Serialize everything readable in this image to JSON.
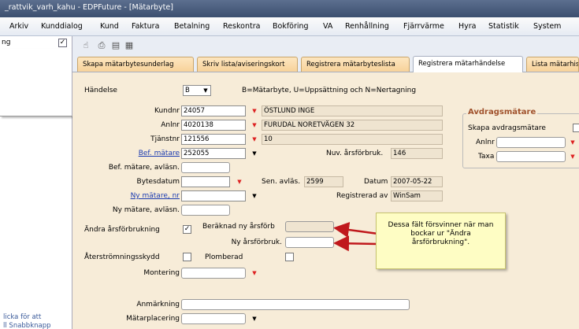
{
  "title": "_rattvik_varh_kahu - EDPFuture - [Mätarbyte]",
  "menu": [
    "Arkiv",
    "Kunddialog",
    "Kund",
    "Faktura",
    "Betalning",
    "Reskontra",
    "Bokföring",
    "VA",
    "Renhållning",
    "Fjärrvärme",
    "Hyra",
    "Statistik",
    "System"
  ],
  "sidebar": {
    "item": "ng",
    "checked": "✓",
    "footer1": "licka för att",
    "footer2": "ll Snabbknapp"
  },
  "tabs": [
    "Skapa mätarbytesunderlag",
    "Skriv lista/aviseringskort",
    "Registrera mätarbyteslista",
    "Registrera mätarhändelse",
    "Lista mätarhis"
  ],
  "form": {
    "handelse_label": "Händelse",
    "handelse_value": "B",
    "handelse_hint": "B=Mätarbyte, U=Uppsättning och N=Nertagning",
    "kundnr_label": "Kundnr",
    "kundnr": "24057",
    "kundnamn": "ÖSTLUND INGE",
    "anlnr_label": "Anlnr",
    "anlnr": "4020138",
    "anladress": "FURUDAL NORETVÄGEN 32",
    "tjanstnr_label": "Tjänstnr",
    "tjanstnr": "121556",
    "tjanst": "10",
    "bef_matare_label": "Bef. mätare",
    "bef_matare": "252055",
    "nuv_arsforbruk_label": "Nuv. årsförbruk.",
    "nuv_arsforbruk": "146",
    "bef_avlasn_label": "Bef. mätare, avläsn.",
    "bytesdatum_label": "Bytesdatum",
    "sen_avlas_label": "Sen. avläs.",
    "sen_avlas": "2599",
    "datum_label": "Datum",
    "datum": "2007-05-22",
    "ny_matare_label": "Ny mätare, nr",
    "registrerad_av_label": "Registrerad av",
    "registrerad_av": "WinSam",
    "ny_avlasn_label": "Ny mätare, avläsn.",
    "andra_label": "Ändra årsförbrukning",
    "andra_checked": "✓",
    "beraknad_label": "Beräknad ny årsförb",
    "ny_arsforbruk_label": "Ny årsförbruk.",
    "aterstromning_label": "Återströmningsskydd",
    "plomberad_label": "Plomberad",
    "montering_label": "Montering",
    "anmarkning_label": "Anmärkning",
    "matarplacering_label": "Mätarplacering"
  },
  "avdrag": {
    "title": "Avdragsmätare",
    "skapa_label": "Skapa avdragsmätare",
    "anlnr_label": "Anlnr",
    "taxa_label": "Taxa"
  },
  "callout": "Dessa fält försvinner när man bockar ur \"Ändra årsförbrukning\"."
}
